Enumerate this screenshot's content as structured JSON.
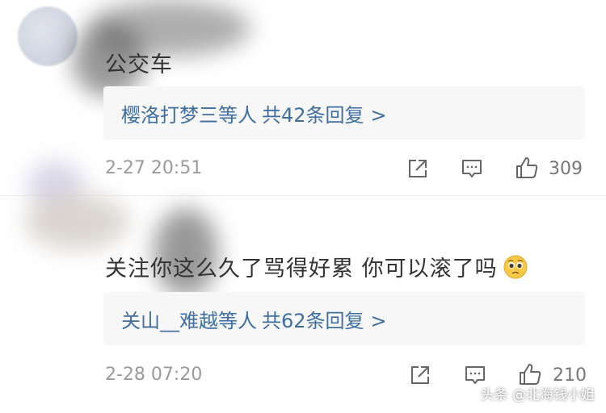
{
  "comments": [
    {
      "text": "公交车",
      "replies": {
        "users": "樱洛打梦三等人",
        "count_label": "共42条回复",
        "chevron": ">"
      },
      "timestamp": "2-27 20:51",
      "likes": "309"
    },
    {
      "text": "关注你这么久了骂得好累 你可以滚了吗",
      "emoji": "pleading-face-emoji",
      "replies": {
        "users": "关山__难越等人",
        "count_label": "共62条回复",
        "chevron": ">"
      },
      "timestamp": "2-28 07:20",
      "likes": "210"
    }
  ],
  "icons": {
    "share": "share-icon",
    "comment": "comment-icon",
    "like": "thumbs-up-icon"
  },
  "colors": {
    "link": "#3f6ea3",
    "muted": "#9a9a9a",
    "reply_bg": "#f7f7f7"
  },
  "watermark": "头条 @北海钱小姐"
}
